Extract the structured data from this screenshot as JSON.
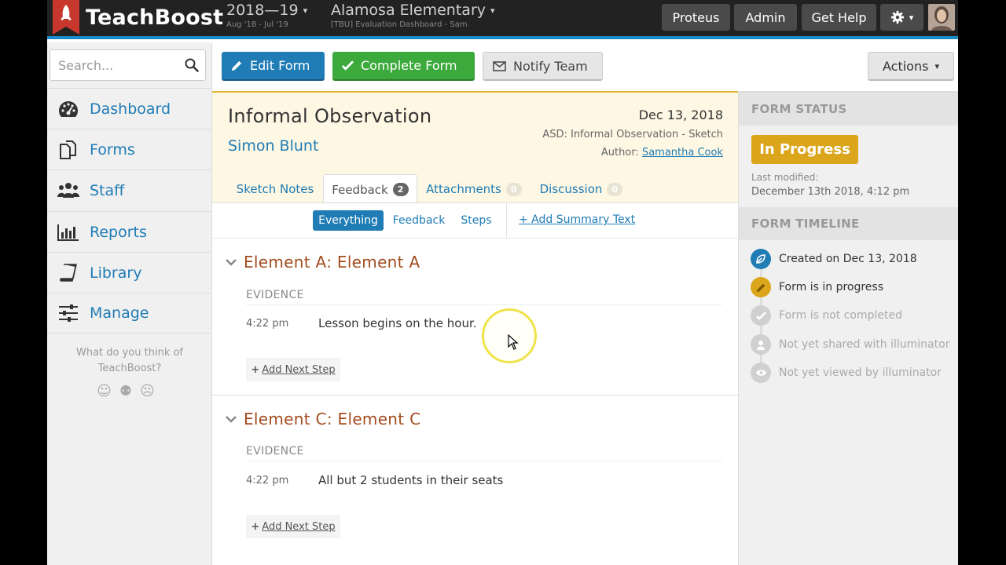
{
  "topbar": {
    "brand": "TeachBoost",
    "year": {
      "main": "2018—19",
      "sub": "Aug '18 - Jul '19"
    },
    "school": {
      "main": "Alamosa Elementary",
      "sub": "[TBU] Evaluation Dashboard - Sam"
    },
    "buttons": {
      "proteus": "Proteus",
      "admin": "Admin",
      "help": "Get Help"
    },
    "accent_color": "#1a8bc6"
  },
  "sidebar": {
    "search_placeholder": "Search...",
    "items": [
      {
        "label": "Dashboard",
        "icon": "dashboard-icon"
      },
      {
        "label": "Forms",
        "icon": "forms-icon"
      },
      {
        "label": "Staff",
        "icon": "staff-icon"
      },
      {
        "label": "Reports",
        "icon": "reports-icon"
      },
      {
        "label": "Library",
        "icon": "library-icon"
      },
      {
        "label": "Manage",
        "icon": "manage-icon"
      }
    ],
    "feedback_question": "What do you think of TeachBoost?",
    "faces": "☺☹☹"
  },
  "toolbar": {
    "edit": "Edit Form",
    "complete": "Complete Form",
    "notify": "Notify Team",
    "actions": "Actions"
  },
  "form": {
    "title": "Informal Observation",
    "teacher": "Simon Blunt",
    "date": "Dec 13, 2018",
    "type": "ASD: Informal Observation - Sketch",
    "author_label": "Author:",
    "author_name": "Samantha Cook",
    "tabs": {
      "sketch": "Sketch Notes",
      "feedback": "Feedback",
      "feedback_count": "2",
      "attachments": "Attachments",
      "attachments_count": "0",
      "discussion": "Discussion",
      "discussion_count": "0"
    },
    "filters": {
      "everything": "Everything",
      "feedback": "Feedback",
      "steps": "Steps",
      "add_summary": "+ Add Summary Text"
    }
  },
  "elements": [
    {
      "title": "Element A: Element A",
      "evidence_label": "EVIDENCE",
      "time": "4:22 pm",
      "text": "Lesson begins on the hour.",
      "next_step": "Add Next Step"
    },
    {
      "title": "Element C: Element C",
      "evidence_label": "EVIDENCE",
      "time": "4:22 pm",
      "text": "All but 2 students in their seats",
      "next_step": "Add Next Step"
    }
  ],
  "status": {
    "header": "FORM STATUS",
    "value": "In Progress",
    "value_color": "#dba61b",
    "lastmod_label": "Last modified:",
    "lastmod_value": "December 13th 2018, 4:12 pm"
  },
  "timeline": {
    "header": "FORM TIMELINE",
    "items": [
      {
        "text": "Created on Dec 13, 2018",
        "icon": "leaf-icon",
        "color": "#1f7cb5"
      },
      {
        "text": "Form is in progress",
        "icon": "pencil-icon",
        "color": "#dba61b"
      },
      {
        "text": "Form is not completed",
        "icon": "check-icon",
        "color": "#d0d0d0"
      },
      {
        "text": "Not yet shared with illuminator",
        "icon": "person-icon",
        "color": "#d0d0d0"
      },
      {
        "text": "Not yet viewed by illuminator",
        "icon": "eye-icon",
        "color": "#d0d0d0"
      }
    ]
  }
}
